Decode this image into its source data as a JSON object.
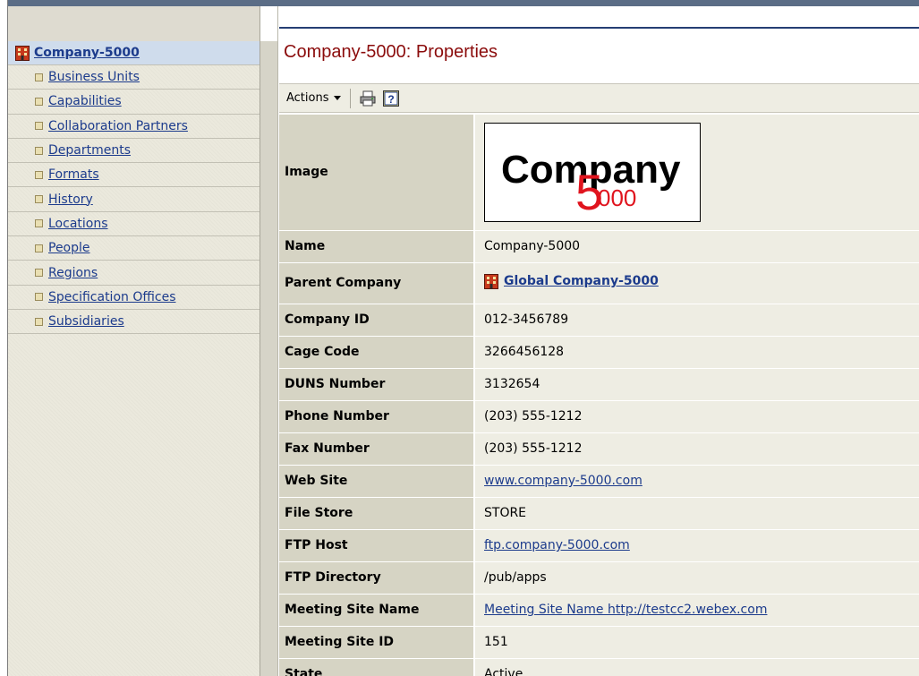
{
  "sidebar": {
    "root": {
      "label": "Company-5000",
      "icon": "building-icon"
    },
    "items": [
      {
        "label": "Business Units"
      },
      {
        "label": "Capabilities"
      },
      {
        "label": "Collaboration Partners"
      },
      {
        "label": "Departments"
      },
      {
        "label": "Formats"
      },
      {
        "label": "History"
      },
      {
        "label": "Locations"
      },
      {
        "label": "People"
      },
      {
        "label": "Regions"
      },
      {
        "label": "Specification Offices"
      },
      {
        "label": "Subsidiaries"
      }
    ]
  },
  "main": {
    "title": "Company-5000: Properties",
    "toolbar": {
      "actions_label": "Actions",
      "print_icon": "print-icon",
      "help_icon": "help-icon"
    },
    "logo": {
      "word": "Company",
      "numeral_5": "5",
      "numeral_000": "000"
    },
    "properties": [
      {
        "label": "Image",
        "value": ""
      },
      {
        "label": "Name",
        "value": "Company-5000"
      },
      {
        "label": "Parent Company",
        "value": "Global Company-5000"
      },
      {
        "label": "Company ID",
        "value": "012-3456789"
      },
      {
        "label": "Cage Code",
        "value": "3266456128"
      },
      {
        "label": "DUNS Number",
        "value": "3132654"
      },
      {
        "label": "Phone Number",
        "value": "(203) 555-1212"
      },
      {
        "label": "Fax Number",
        "value": "(203) 555-1212"
      },
      {
        "label": "Web Site",
        "value": "www.company-5000.com"
      },
      {
        "label": "File Store",
        "value": "STORE"
      },
      {
        "label": "FTP Host",
        "value": "ftp.company-5000.com"
      },
      {
        "label": "FTP Directory",
        "value": "/pub/apps"
      },
      {
        "label": "Meeting Site Name",
        "value": "Meeting Site Name http://testcc2.webex.com"
      },
      {
        "label": "Meeting Site ID",
        "value": "151"
      },
      {
        "label": "State",
        "value": "Active"
      }
    ]
  },
  "colors": {
    "title": "#8b0c0c",
    "link": "#1c3b8c",
    "label_bg": "#d6d4c4",
    "value_bg": "#eeede3",
    "logo_red": "#e0141e"
  }
}
